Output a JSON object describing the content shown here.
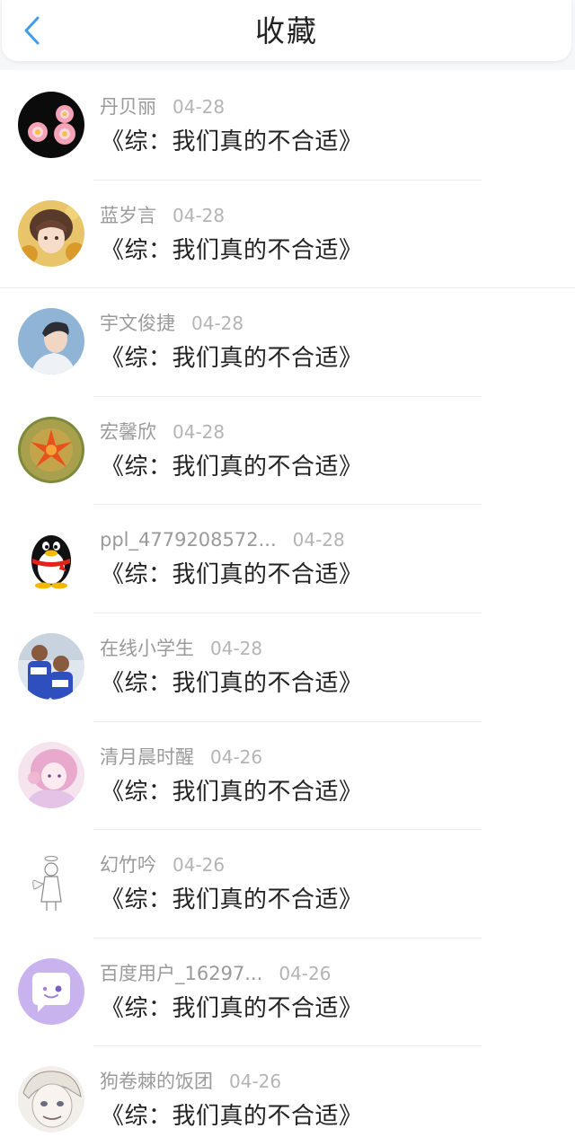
{
  "header": {
    "title": "收藏",
    "back_icon": "chevron-left-icon",
    "accent_color": "#3e9ee8"
  },
  "items": [
    {
      "name": "丹贝丽",
      "date": "04-28",
      "title": "《综：我们真的不合适》",
      "avatar": "pink-flowers-avatar"
    },
    {
      "name": "蓝岁言",
      "date": "04-28",
      "title": "《综：我们真的不合适》",
      "avatar": "anime-boy-sunflowers-avatar"
    },
    {
      "name": "宇文俊捷",
      "date": "04-28",
      "title": "《综：我们真的不合适》",
      "avatar": "boy-portrait-avatar"
    },
    {
      "name": "宏馨欣",
      "date": "04-28",
      "title": "《综：我们真的不合适》",
      "avatar": "orange-flower-cactus-avatar"
    },
    {
      "name": "ppl_4779208572...",
      "date": "04-28",
      "title": "《综：我们真的不合适》",
      "avatar": "qq-penguin-avatar"
    },
    {
      "name": "在线小学生",
      "date": "04-28",
      "title": "《综：我们真的不合适》",
      "avatar": "two-kids-avatar"
    },
    {
      "name": "清月晨时醒",
      "date": "04-26",
      "title": "《综：我们真的不合适》",
      "avatar": "pink-anime-girl-avatar"
    },
    {
      "name": "幻竹吟",
      "date": "04-26",
      "title": "《综：我们真的不合适》",
      "avatar": "angel-sketch-avatar"
    },
    {
      "name": "百度用户_16297...",
      "date": "04-26",
      "title": "《综：我们真的不合适》",
      "avatar": "purple-chat-bubble-avatar"
    },
    {
      "name": "狗卷棘的饭团",
      "date": "04-26",
      "title": "《综：我们真的不合适》",
      "avatar": "anime-sketch-avatar"
    }
  ]
}
